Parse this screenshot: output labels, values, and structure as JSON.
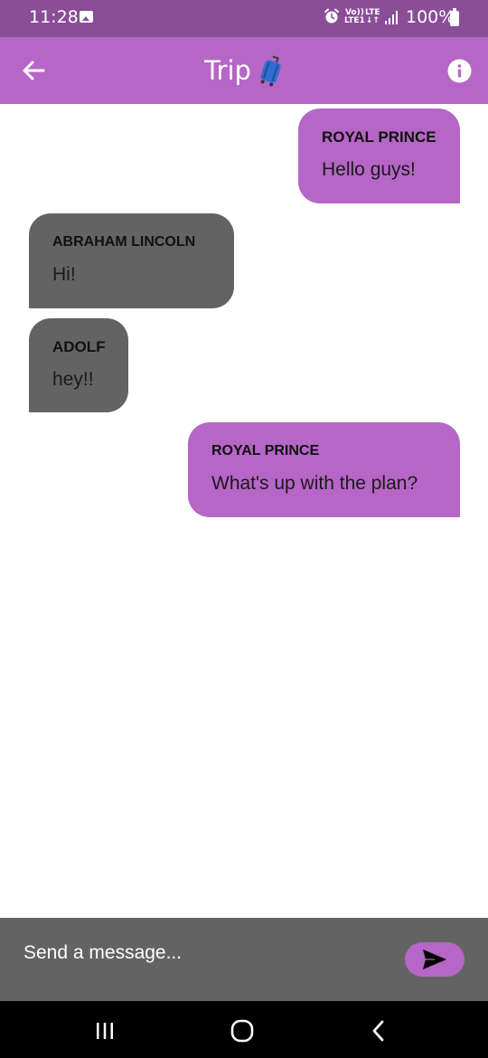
{
  "status_bar": {
    "time": "11:28",
    "volte_top": "Vo))",
    "volte_bottom": "LTE1",
    "lte_top": "LTE",
    "lte_bottom": "↓↑",
    "battery": "100%"
  },
  "app_bar": {
    "title": "Trip",
    "title_icon": "luggage-icon",
    "back_icon": "arrow-left-icon",
    "info_icon": "info-icon"
  },
  "messages": [
    {
      "sender": "ROYAL PRINCE",
      "text": "Hello guys!",
      "mine": true
    },
    {
      "sender": "ABRAHAM LINCOLN",
      "text": "Hi!",
      "mine": false
    },
    {
      "sender": "ADOLF",
      "text": "hey!!",
      "mine": false
    },
    {
      "sender": "ROYAL PRINCE",
      "text": "What's up with the plan?",
      "mine": true
    }
  ],
  "composer": {
    "placeholder": "Send a message...",
    "value": "",
    "send_icon": "send-icon"
  },
  "colors": {
    "status_bar": "#8a4d97",
    "accent": "#b666c6",
    "other_bubble": "#636363",
    "composer": "#636363",
    "nav_bar": "#000000"
  },
  "nav_bar": {
    "recent_icon": "recent-apps-icon",
    "home_icon": "home-icon",
    "back_icon": "nav-back-icon"
  }
}
